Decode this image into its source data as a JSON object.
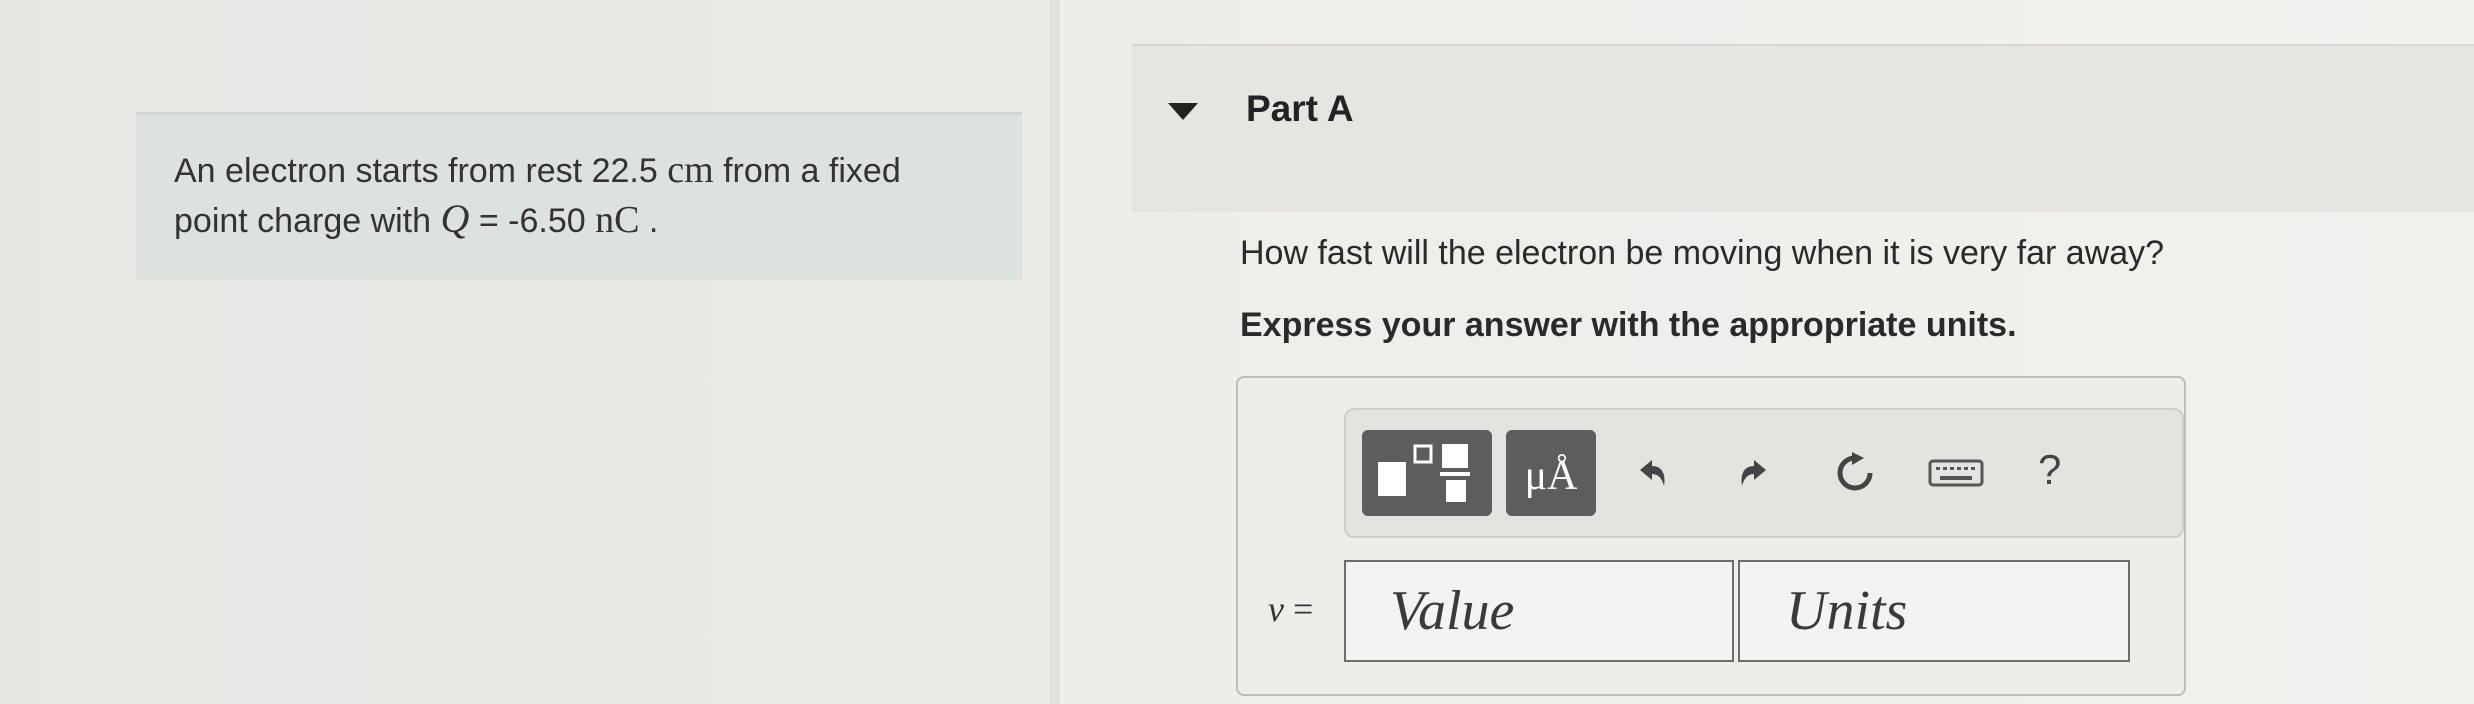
{
  "problem": {
    "text_1": "An electron starts from rest 22.5",
    "distance_unit": "cm",
    "text_2": "from a fixed",
    "text_3": "point charge with",
    "charge_symbol": "Q",
    "equals": "=",
    "charge_value": "-6.50",
    "charge_unit": "nC",
    "period": "."
  },
  "part": {
    "title": "Part A",
    "question": "How fast will the electron be moving when it is very far away?",
    "instruction": "Express your answer with the appropriate units."
  },
  "toolbar": {
    "units_label": "μÅ",
    "help_label": "?",
    "icons": [
      "templates-icon",
      "units-icon",
      "undo-icon",
      "redo-icon",
      "reset-icon",
      "keyboard-icon",
      "help-icon"
    ]
  },
  "answer": {
    "variable": "v",
    "equals": "=",
    "value_placeholder": "Value",
    "units_placeholder": "Units"
  }
}
